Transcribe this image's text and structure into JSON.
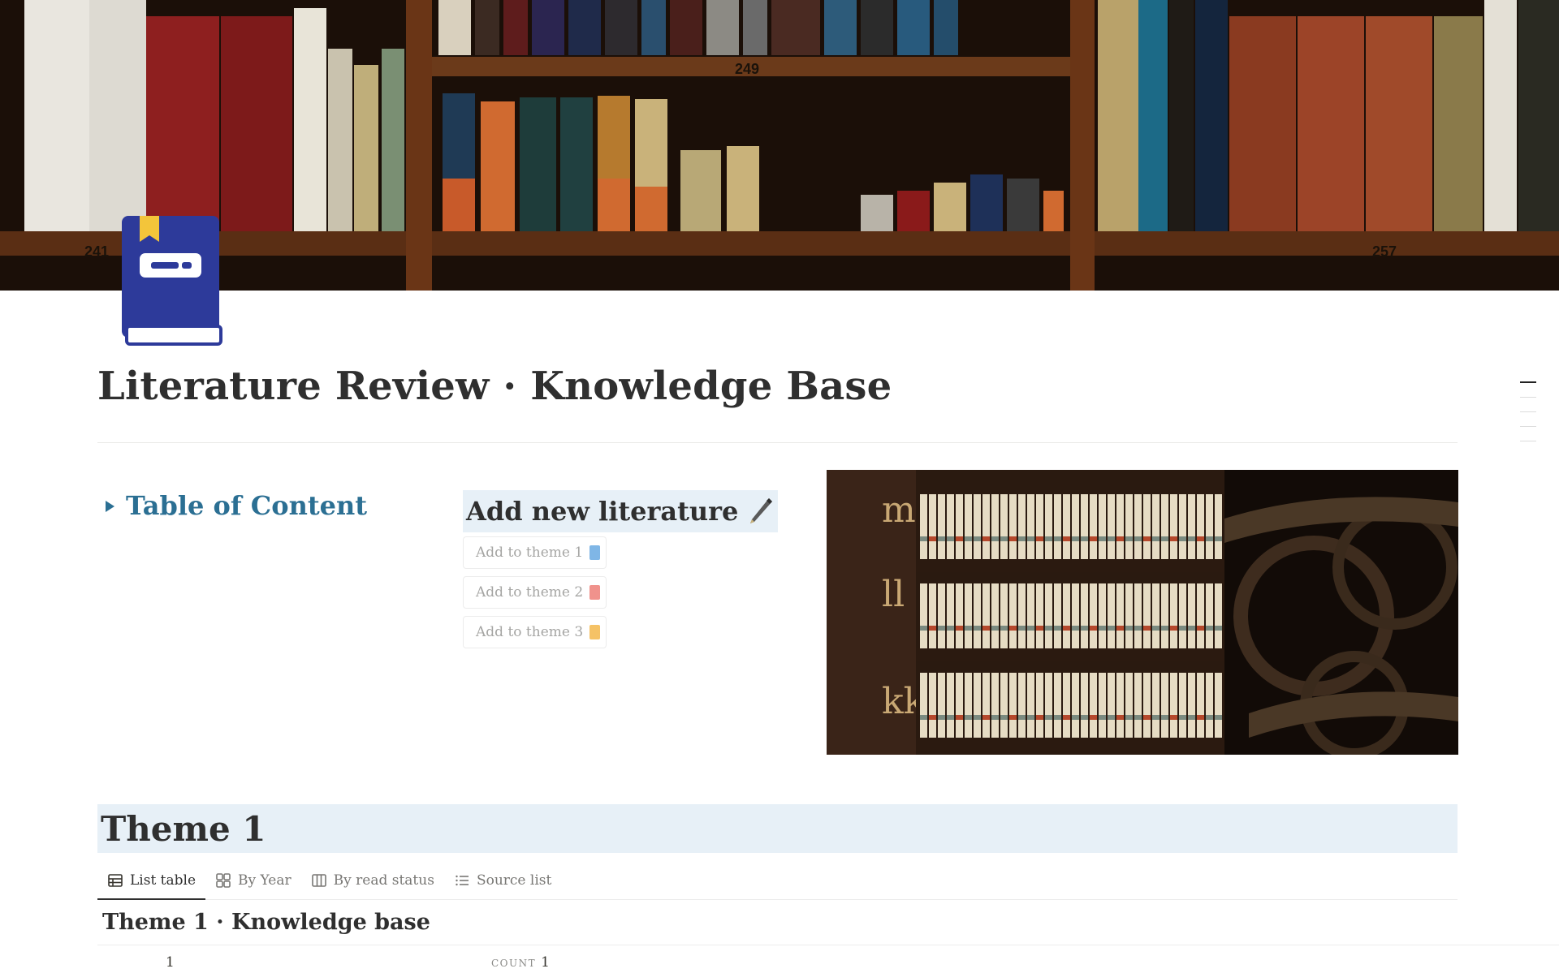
{
  "page": {
    "title": "Literature Review · Knowledge Base",
    "icon": "book-icon"
  },
  "cover": {
    "shelf_numbers": [
      "249",
      "241",
      "257"
    ]
  },
  "toc": {
    "label": "Table of Content"
  },
  "add_literature": {
    "heading": "Add new literature",
    "heading_icon": "pen-icon",
    "buttons": [
      {
        "label": "Add to theme 1",
        "color": "#7fb6e6"
      },
      {
        "label": "Add to theme 2",
        "color": "#f0928c"
      },
      {
        "label": "Add to theme 3",
        "color": "#f5c266"
      }
    ]
  },
  "library_image": {
    "spine_letters": [
      "m",
      "ll",
      "kk"
    ]
  },
  "theme": {
    "heading": "Theme 1",
    "tabs": [
      {
        "label": "List table",
        "icon": "table-icon"
      },
      {
        "label": "By Year",
        "icon": "gallery-icon"
      },
      {
        "label": "By read status",
        "icon": "board-icon"
      },
      {
        "label": "Source list",
        "icon": "list-icon"
      }
    ],
    "database_title": "Theme 1 · Knowledge base",
    "row_number": "1",
    "count_label": "COUNT",
    "count_value": "1"
  },
  "colors": {
    "accent_blue": "#2b6f93",
    "heading_bg": "#e7f0f7",
    "icon_blue": "#2d3a9a",
    "icon_gold": "#f3c53a"
  }
}
